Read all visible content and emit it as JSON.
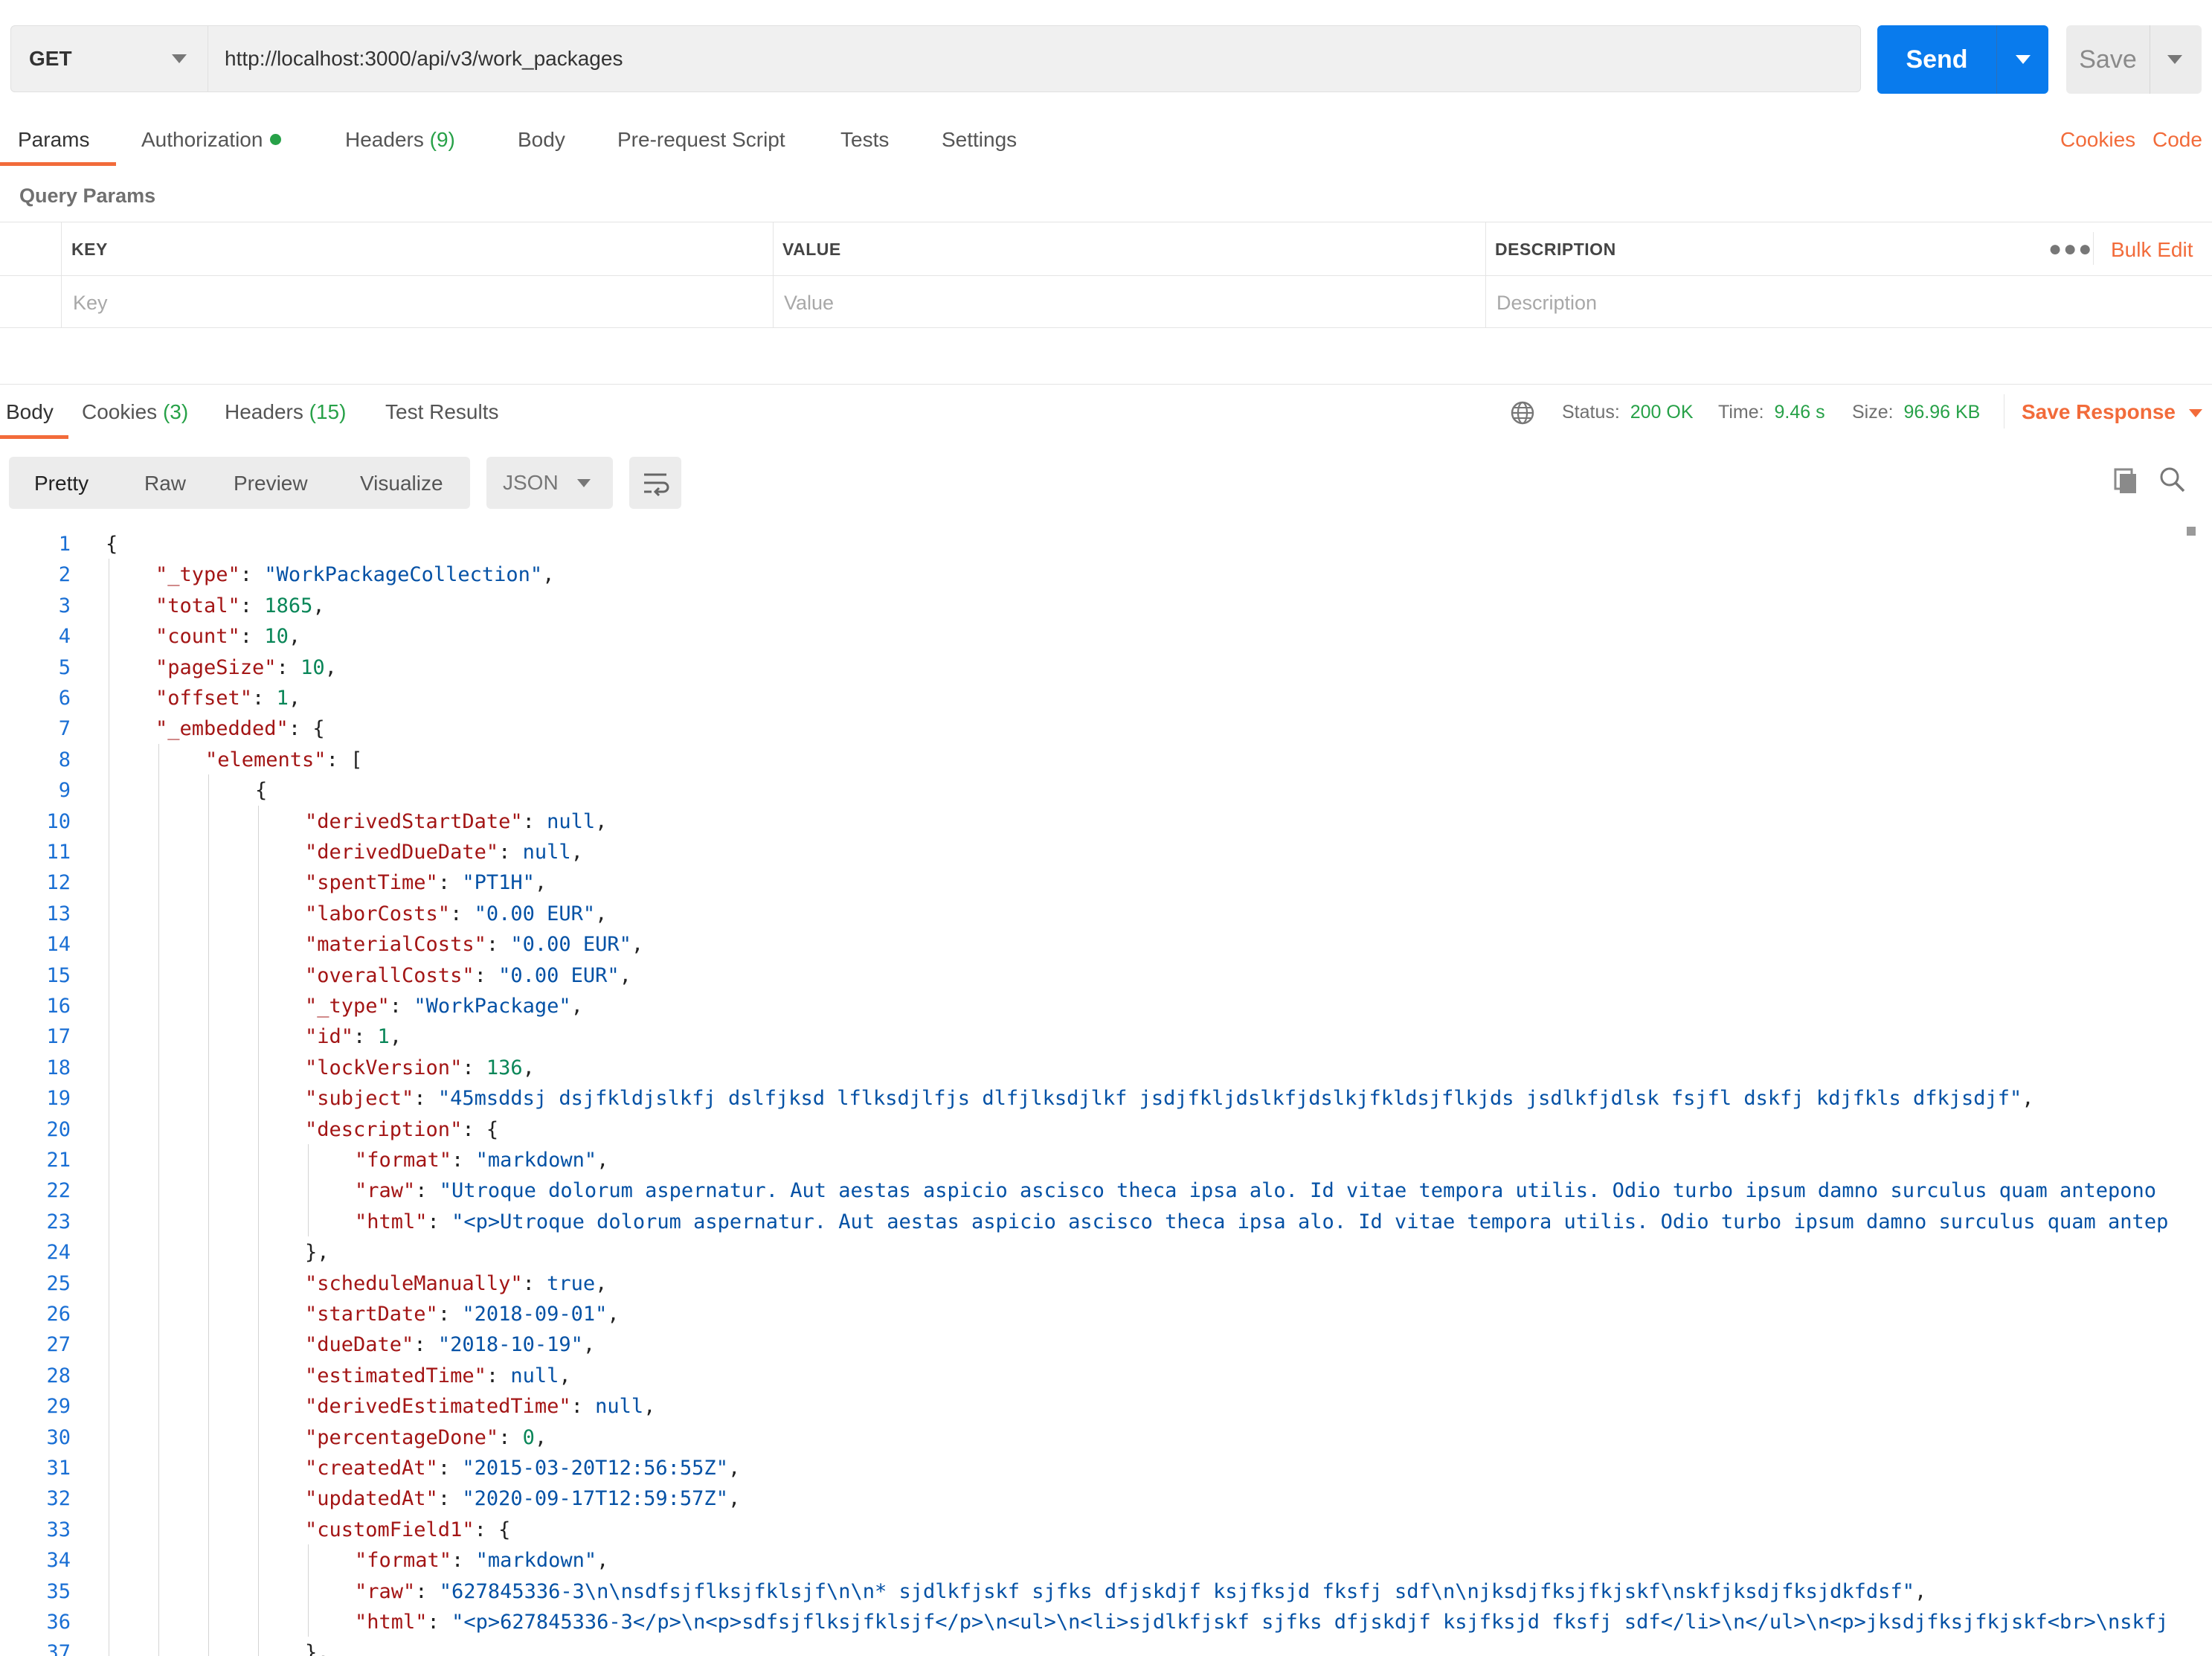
{
  "request": {
    "method": "GET",
    "url": "http://localhost:3000/api/v3/work_packages",
    "send_label": "Send",
    "save_label": "Save"
  },
  "request_tabs": [
    {
      "id": "params",
      "label": "Params"
    },
    {
      "id": "authorization",
      "label": "Authorization"
    },
    {
      "id": "headers",
      "label": "Headers",
      "count": "(9)"
    },
    {
      "id": "body",
      "label": "Body"
    },
    {
      "id": "pre-request-script",
      "label": "Pre-request Script"
    },
    {
      "id": "tests",
      "label": "Tests"
    },
    {
      "id": "settings",
      "label": "Settings"
    }
  ],
  "request_links": {
    "cookies": "Cookies",
    "code": "Code"
  },
  "query_params": {
    "title": "Query Params",
    "columns": [
      "KEY",
      "VALUE",
      "DESCRIPTION"
    ],
    "placeholders": {
      "key": "Key",
      "value": "Value",
      "description": "Description"
    },
    "bulk_edit": "Bulk Edit"
  },
  "response_tabs": [
    {
      "id": "body",
      "label": "Body"
    },
    {
      "id": "cookies",
      "label": "Cookies",
      "count": "(3)"
    },
    {
      "id": "headers",
      "label": "Headers",
      "count": "(15)"
    },
    {
      "id": "test-results",
      "label": "Test Results"
    }
  ],
  "response_status": {
    "status_label": "Status:",
    "status_value": "200 OK",
    "time_label": "Time:",
    "time_value": "9.46 s",
    "size_label": "Size:",
    "size_value": "96.96 KB",
    "save_response": "Save Response"
  },
  "view_modes": [
    "Pretty",
    "Raw",
    "Preview",
    "Visualize"
  ],
  "format": "JSON",
  "icons": {
    "globe": "globe-icon",
    "wrap": "wrap-lines-icon",
    "copy": "copy-icon",
    "search": "search-icon",
    "more": "more-horizontal-icon"
  },
  "colors": {
    "accent": "#f26b3a",
    "send": "#097bed",
    "success": "#27a148",
    "json_key": "#a31515",
    "json_string": "#0451a5",
    "json_number": "#098658"
  },
  "code_lines": [
    {
      "n": "1",
      "indent": 0,
      "t": [
        [
          "p",
          "{"
        ]
      ]
    },
    {
      "n": "2",
      "indent": 1,
      "t": [
        [
          "k",
          "\"_type\""
        ],
        [
          "p",
          ": "
        ],
        [
          "s",
          "\"WorkPackageCollection\""
        ],
        [
          "p",
          ","
        ]
      ]
    },
    {
      "n": "3",
      "indent": 1,
      "t": [
        [
          "k",
          "\"total\""
        ],
        [
          "p",
          ": "
        ],
        [
          "n",
          "1865"
        ],
        [
          "p",
          ","
        ]
      ]
    },
    {
      "n": "4",
      "indent": 1,
      "t": [
        [
          "k",
          "\"count\""
        ],
        [
          "p",
          ": "
        ],
        [
          "n",
          "10"
        ],
        [
          "p",
          ","
        ]
      ]
    },
    {
      "n": "5",
      "indent": 1,
      "t": [
        [
          "k",
          "\"pageSize\""
        ],
        [
          "p",
          ": "
        ],
        [
          "n",
          "10"
        ],
        [
          "p",
          ","
        ]
      ]
    },
    {
      "n": "6",
      "indent": 1,
      "t": [
        [
          "k",
          "\"offset\""
        ],
        [
          "p",
          ": "
        ],
        [
          "n",
          "1"
        ],
        [
          "p",
          ","
        ]
      ]
    },
    {
      "n": "7",
      "indent": 1,
      "t": [
        [
          "k",
          "\"_embedded\""
        ],
        [
          "p",
          ": {"
        ]
      ]
    },
    {
      "n": "8",
      "indent": 2,
      "t": [
        [
          "k",
          "\"elements\""
        ],
        [
          "p",
          ": ["
        ]
      ]
    },
    {
      "n": "9",
      "indent": 3,
      "t": [
        [
          "p",
          "{"
        ]
      ]
    },
    {
      "n": "10",
      "indent": 4,
      "t": [
        [
          "k",
          "\"derivedStartDate\""
        ],
        [
          "p",
          ": "
        ],
        [
          "l",
          "null"
        ],
        [
          "p",
          ","
        ]
      ]
    },
    {
      "n": "11",
      "indent": 4,
      "t": [
        [
          "k",
          "\"derivedDueDate\""
        ],
        [
          "p",
          ": "
        ],
        [
          "l",
          "null"
        ],
        [
          "p",
          ","
        ]
      ]
    },
    {
      "n": "12",
      "indent": 4,
      "t": [
        [
          "k",
          "\"spentTime\""
        ],
        [
          "p",
          ": "
        ],
        [
          "s",
          "\"PT1H\""
        ],
        [
          "p",
          ","
        ]
      ]
    },
    {
      "n": "13",
      "indent": 4,
      "t": [
        [
          "k",
          "\"laborCosts\""
        ],
        [
          "p",
          ": "
        ],
        [
          "s",
          "\"0.00 EUR\""
        ],
        [
          "p",
          ","
        ]
      ]
    },
    {
      "n": "14",
      "indent": 4,
      "t": [
        [
          "k",
          "\"materialCosts\""
        ],
        [
          "p",
          ": "
        ],
        [
          "s",
          "\"0.00 EUR\""
        ],
        [
          "p",
          ","
        ]
      ]
    },
    {
      "n": "15",
      "indent": 4,
      "t": [
        [
          "k",
          "\"overallCosts\""
        ],
        [
          "p",
          ": "
        ],
        [
          "s",
          "\"0.00 EUR\""
        ],
        [
          "p",
          ","
        ]
      ]
    },
    {
      "n": "16",
      "indent": 4,
      "t": [
        [
          "k",
          "\"_type\""
        ],
        [
          "p",
          ": "
        ],
        [
          "s",
          "\"WorkPackage\""
        ],
        [
          "p",
          ","
        ]
      ]
    },
    {
      "n": "17",
      "indent": 4,
      "t": [
        [
          "k",
          "\"id\""
        ],
        [
          "p",
          ": "
        ],
        [
          "n",
          "1"
        ],
        [
          "p",
          ","
        ]
      ]
    },
    {
      "n": "18",
      "indent": 4,
      "t": [
        [
          "k",
          "\"lockVersion\""
        ],
        [
          "p",
          ": "
        ],
        [
          "n",
          "136"
        ],
        [
          "p",
          ","
        ]
      ]
    },
    {
      "n": "19",
      "indent": 4,
      "t": [
        [
          "k",
          "\"subject\""
        ],
        [
          "p",
          ": "
        ],
        [
          "s",
          "\"45msddsj dsjfkldjslkfj dslfjksd lflksdjlfjs dlfjlksdjlkf jsdjfkljdslkfjdslkjfkldsjflkjds jsdlkfjdlsk fsjfl dskfj kdjfkls dfkjsdjf\""
        ],
        [
          "p",
          ","
        ]
      ]
    },
    {
      "n": "20",
      "indent": 4,
      "t": [
        [
          "k",
          "\"description\""
        ],
        [
          "p",
          ": {"
        ]
      ]
    },
    {
      "n": "21",
      "indent": 5,
      "t": [
        [
          "k",
          "\"format\""
        ],
        [
          "p",
          ": "
        ],
        [
          "s",
          "\"markdown\""
        ],
        [
          "p",
          ","
        ]
      ]
    },
    {
      "n": "22",
      "indent": 5,
      "t": [
        [
          "k",
          "\"raw\""
        ],
        [
          "p",
          ": "
        ],
        [
          "s",
          "\"Utroque dolorum aspernatur. Aut aestas aspicio ascisco theca ipsa alo. Id vitae tempora utilis. Odio turbo ipsum damno surculus quam antepono"
        ]
      ]
    },
    {
      "n": "23",
      "indent": 5,
      "t": [
        [
          "k",
          "\"html\""
        ],
        [
          "p",
          ": "
        ],
        [
          "s",
          "\"<p>Utroque dolorum aspernatur. Aut aestas aspicio ascisco theca ipsa alo. Id vitae tempora utilis. Odio turbo ipsum damno surculus quam antep"
        ]
      ]
    },
    {
      "n": "24",
      "indent": 4,
      "t": [
        [
          "p",
          "},"
        ]
      ]
    },
    {
      "n": "25",
      "indent": 4,
      "t": [
        [
          "k",
          "\"scheduleManually\""
        ],
        [
          "p",
          ": "
        ],
        [
          "l",
          "true"
        ],
        [
          "p",
          ","
        ]
      ]
    },
    {
      "n": "26",
      "indent": 4,
      "t": [
        [
          "k",
          "\"startDate\""
        ],
        [
          "p",
          ": "
        ],
        [
          "s",
          "\"2018-09-01\""
        ],
        [
          "p",
          ","
        ]
      ]
    },
    {
      "n": "27",
      "indent": 4,
      "t": [
        [
          "k",
          "\"dueDate\""
        ],
        [
          "p",
          ": "
        ],
        [
          "s",
          "\"2018-10-19\""
        ],
        [
          "p",
          ","
        ]
      ]
    },
    {
      "n": "28",
      "indent": 4,
      "t": [
        [
          "k",
          "\"estimatedTime\""
        ],
        [
          "p",
          ": "
        ],
        [
          "l",
          "null"
        ],
        [
          "p",
          ","
        ]
      ]
    },
    {
      "n": "29",
      "indent": 4,
      "t": [
        [
          "k",
          "\"derivedEstimatedTime\""
        ],
        [
          "p",
          ": "
        ],
        [
          "l",
          "null"
        ],
        [
          "p",
          ","
        ]
      ]
    },
    {
      "n": "30",
      "indent": 4,
      "t": [
        [
          "k",
          "\"percentageDone\""
        ],
        [
          "p",
          ": "
        ],
        [
          "n",
          "0"
        ],
        [
          "p",
          ","
        ]
      ]
    },
    {
      "n": "31",
      "indent": 4,
      "t": [
        [
          "k",
          "\"createdAt\""
        ],
        [
          "p",
          ": "
        ],
        [
          "s",
          "\"2015-03-20T12:56:55Z\""
        ],
        [
          "p",
          ","
        ]
      ]
    },
    {
      "n": "32",
      "indent": 4,
      "t": [
        [
          "k",
          "\"updatedAt\""
        ],
        [
          "p",
          ": "
        ],
        [
          "s",
          "\"2020-09-17T12:59:57Z\""
        ],
        [
          "p",
          ","
        ]
      ]
    },
    {
      "n": "33",
      "indent": 4,
      "t": [
        [
          "k",
          "\"customField1\""
        ],
        [
          "p",
          ": {"
        ]
      ]
    },
    {
      "n": "34",
      "indent": 5,
      "t": [
        [
          "k",
          "\"format\""
        ],
        [
          "p",
          ": "
        ],
        [
          "s",
          "\"markdown\""
        ],
        [
          "p",
          ","
        ]
      ]
    },
    {
      "n": "35",
      "indent": 5,
      "t": [
        [
          "k",
          "\"raw\""
        ],
        [
          "p",
          ": "
        ],
        [
          "s",
          "\"627845336-3\\n\\nsdfsjflksjfklsjf\\n\\n* sjdlkfjskf sjfks dfjskdjf ksjfksjd fksfj sdf\\n\\njksdjfksjfkjskf\\nskfjksdjfksjdkfdsf\""
        ],
        [
          "p",
          ","
        ]
      ]
    },
    {
      "n": "36",
      "indent": 5,
      "t": [
        [
          "k",
          "\"html\""
        ],
        [
          "p",
          ": "
        ],
        [
          "s",
          "\"<p>627845336-3</p>\\n<p>sdfsjflksjfklsjf</p>\\n<ul>\\n<li>sjdlkfjskf sjfks dfjskdjf ksjfksjd fksfj sdf</li>\\n</ul>\\n<p>jksdjfksjfkjskf<br>\\nskfj"
        ]
      ]
    },
    {
      "n": "37",
      "indent": 4,
      "t": [
        [
          "p",
          "},"
        ]
      ]
    }
  ]
}
